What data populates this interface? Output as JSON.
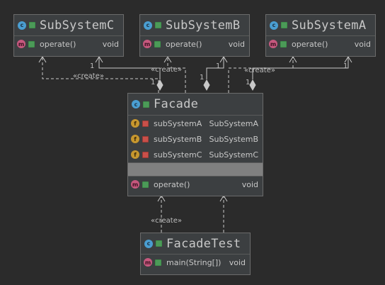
{
  "classes": {
    "subsystem_c": {
      "name": "SubSystemC",
      "methods": [
        {
          "name": "operate()",
          "type": "void"
        }
      ]
    },
    "subsystem_b": {
      "name": "SubSystemB",
      "methods": [
        {
          "name": "operate()",
          "type": "void"
        }
      ]
    },
    "subsystem_a": {
      "name": "SubSystemA",
      "methods": [
        {
          "name": "operate()",
          "type": "void"
        }
      ]
    },
    "facade": {
      "name": "Facade",
      "fields": [
        {
          "name": "subSystemA",
          "type": "SubSystemA"
        },
        {
          "name": "subSystemB",
          "type": "SubSystemB"
        },
        {
          "name": "subSystemC",
          "type": "SubSystemC"
        }
      ],
      "methods": [
        {
          "name": "operate()",
          "type": "void"
        }
      ]
    },
    "facade_test": {
      "name": "FacadeTest",
      "methods": [
        {
          "name": "main(String[])",
          "type": "void"
        }
      ]
    }
  },
  "icons": {
    "class_letter": "c",
    "method_letter": "m",
    "field_letter": "f"
  },
  "relations": {
    "create_label": "«create»",
    "multiplicity": "1"
  },
  "colors": {
    "background": "#2b2b2b",
    "box": "#3c3f41",
    "class_icon": "#4a9ed1",
    "method_icon": "#c6587e",
    "field_icon": "#c7972e",
    "line": "#c8c8c8"
  }
}
